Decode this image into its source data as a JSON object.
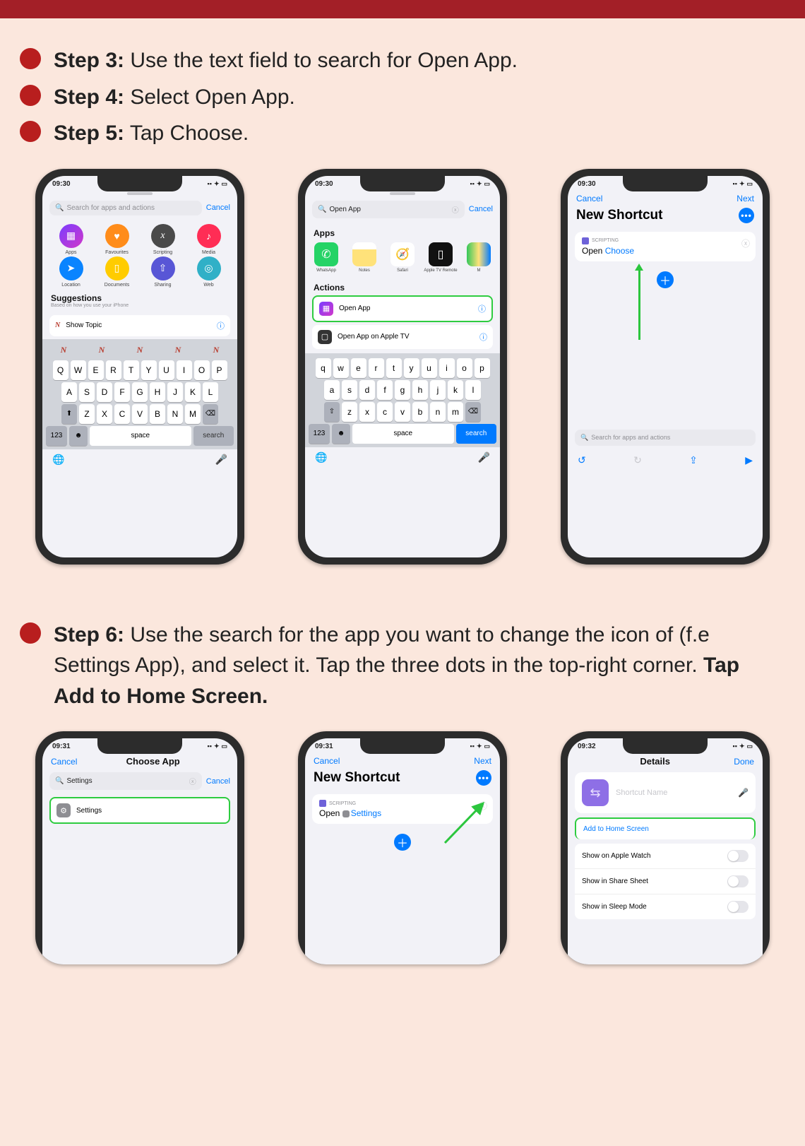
{
  "steps_top": [
    {
      "label": "Step  3:",
      "text": " Use the text field to search for Open App."
    },
    {
      "label": "Step 4:",
      "text": " Select Open App."
    },
    {
      "label": "Step 5:",
      "text": " Tap Choose."
    }
  ],
  "step6": {
    "label": "Step 6:",
    "text_a": " Use the search for the app you want to change the icon of (f.e Settings App), and select it. Tap the three dots in the top-right corner. ",
    "bold": "Tap Add to Home Screen."
  },
  "time1": "09:30",
  "time2": "09:31",
  "time3": "09:32",
  "p1": {
    "search_ph": "Search for apps and actions",
    "cancel": "Cancel",
    "cats": [
      "Apps",
      "Favourites",
      "Scripting",
      "Media",
      "Location",
      "Documents",
      "Sharing",
      "Web"
    ],
    "sugg_h": "Suggestions",
    "sugg_sub": "Based on how you use your iPhone",
    "action": "Show Topic",
    "kb_rows": [
      [
        "Q",
        "W",
        "E",
        "R",
        "T",
        "Y",
        "U",
        "I",
        "O",
        "P"
      ],
      [
        "A",
        "S",
        "D",
        "F",
        "G",
        "H",
        "J",
        "K",
        "L"
      ],
      [
        "Z",
        "X",
        "C",
        "V",
        "B",
        "N",
        "M"
      ]
    ],
    "space": "space",
    "search_btn": "search",
    "num": "123"
  },
  "p2": {
    "search_val": "Open App",
    "cancel": "Cancel",
    "apps_h": "Apps",
    "apps": [
      "WhatsApp",
      "Notes",
      "Safari",
      "Apple TV Remote",
      "M"
    ],
    "actions_h": "Actions",
    "a1": "Open App",
    "a2": "Open App on Apple TV",
    "kb_rows": [
      [
        "q",
        "w",
        "e",
        "r",
        "t",
        "y",
        "u",
        "i",
        "o",
        "p"
      ],
      [
        "a",
        "s",
        "d",
        "f",
        "g",
        "h",
        "j",
        "k",
        "l"
      ],
      [
        "z",
        "x",
        "c",
        "v",
        "b",
        "n",
        "m"
      ]
    ],
    "space": "space",
    "search_btn": "search",
    "num": "123"
  },
  "p3": {
    "cancel": "Cancel",
    "next": "Next",
    "title": "New Shortcut",
    "tag": "SCRIPTING",
    "open": "Open",
    "choose": "Choose",
    "search_ph": "Search for apps and actions"
  },
  "p4": {
    "cancel": "Cancel",
    "choose_app": "Choose App",
    "search_val": "Settings",
    "cancel2": "Cancel",
    "res": "Settings"
  },
  "p5": {
    "cancel": "Cancel",
    "next": "Next",
    "title": "New Shortcut",
    "tag": "SCRIPTING",
    "open": "Open",
    "app": "Settings"
  },
  "p6": {
    "details": "Details",
    "done": "Done",
    "name_ph": "Shortcut Name",
    "add": "Add to Home Screen",
    "opts": [
      "Show on Apple Watch",
      "Show in Share Sheet",
      "Show in Sleep Mode"
    ]
  }
}
